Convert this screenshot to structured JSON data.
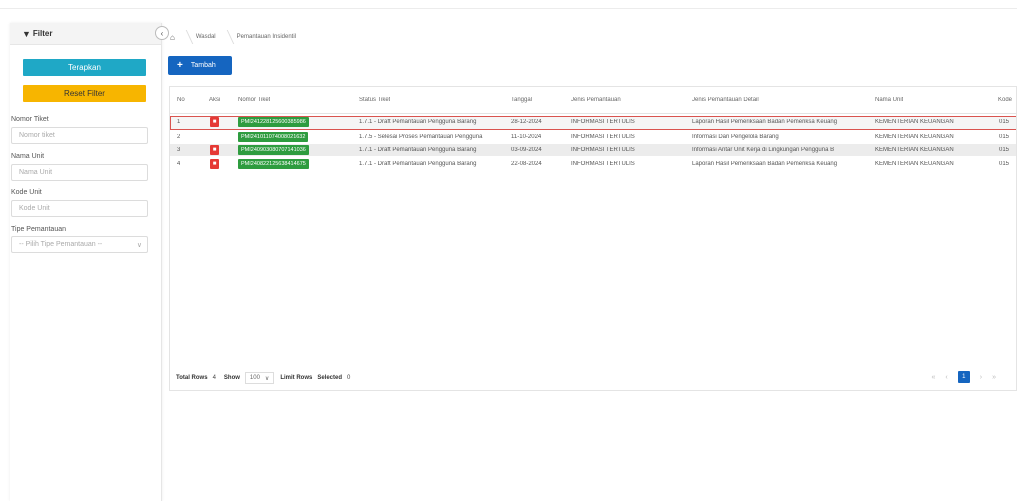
{
  "filter": {
    "title": "Filter",
    "apply_label": "Terapkan",
    "reset_label": "Reset Filter",
    "fields": [
      {
        "label": "Nomor Tiket",
        "placeholder": "Nomor tiket"
      },
      {
        "label": "Nama Unit",
        "placeholder": "Nama Unit"
      },
      {
        "label": "Kode Unit",
        "placeholder": "Kode Unit"
      }
    ],
    "type": {
      "label": "Tipe Pemantauan",
      "selected": "-- Pilih Tipe Pemantauan --"
    }
  },
  "breadcrumb": [
    "Wasdal",
    "Pemantauan Insidentil"
  ],
  "add_label": "Tambah",
  "table": {
    "columns": [
      "No",
      "Aksi",
      "Nomor Tiket",
      "Status Tiket",
      "Tanggal",
      "Jenis Pemantauan",
      "Jenis Pemantauan Detail",
      "Nama Unit",
      "Kode"
    ],
    "rows": [
      {
        "no": "1",
        "has_delete": true,
        "ticket": "PMI241228125600385986",
        "status": "1.7.1 - Draft Pemantauan Pengguna Barang",
        "date": "28-12-2024",
        "type": "INFORMASI TERTULIS",
        "detail": "Laporan Hasil Pemeriksaan Badan Pemeriksa Keuang",
        "unit": "KEMENTERIAN KEUANGAN",
        "code": "015"
      },
      {
        "no": "2",
        "has_delete": false,
        "ticket": "PMI241011074008021632",
        "status": "1.7.5 - Selesai Proses Pemantauan Pengguna",
        "date": "11-10-2024",
        "type": "INFORMASI TERTULIS",
        "detail": "Informasi Dari Pengelola Barang",
        "unit": "KEMENTERIAN KEUANGAN",
        "code": "015"
      },
      {
        "no": "3",
        "has_delete": true,
        "ticket": "PMI240903080707141036",
        "status": "1.7.1 - Draft Pemantauan Pengguna Barang",
        "date": "03-09-2024",
        "type": "INFORMASI TERTULIS",
        "detail": "Informasi Antar Unit Kerja di Lingkungan Pengguna B",
        "unit": "KEMENTERIAN KEUANGAN",
        "code": "015"
      },
      {
        "no": "4",
        "has_delete": true,
        "ticket": "PMI240822125638414675",
        "status": "1.7.1 - Draft Pemantauan Pengguna Barang",
        "date": "22-08-2024",
        "type": "INFORMASI TERTULIS",
        "detail": "Laporan Hasil Pemeriksaan Badan Pemeriksa Keuang",
        "unit": "KEMENTERIAN KEUANGAN",
        "code": "015"
      }
    ]
  },
  "footer": {
    "total_label": "Total Rows",
    "total_value": "4",
    "show_label": "Show",
    "show_value": "100",
    "limit_label": "Limit Rows",
    "selected_label": "Selected",
    "selected_value": "0",
    "current_page": "1"
  },
  "colors": {
    "apply": "#1fa8c6",
    "reset": "#f7b500",
    "primary": "#1565c0",
    "ticket": "#2e9c3f",
    "delete": "#e53935",
    "selected_outline": "#d9534f"
  },
  "icons": {
    "filter": "funnel-icon",
    "collapse": "chevron-left-icon",
    "home": "home-icon",
    "add": "plus-icon",
    "delete": "trash-icon"
  }
}
